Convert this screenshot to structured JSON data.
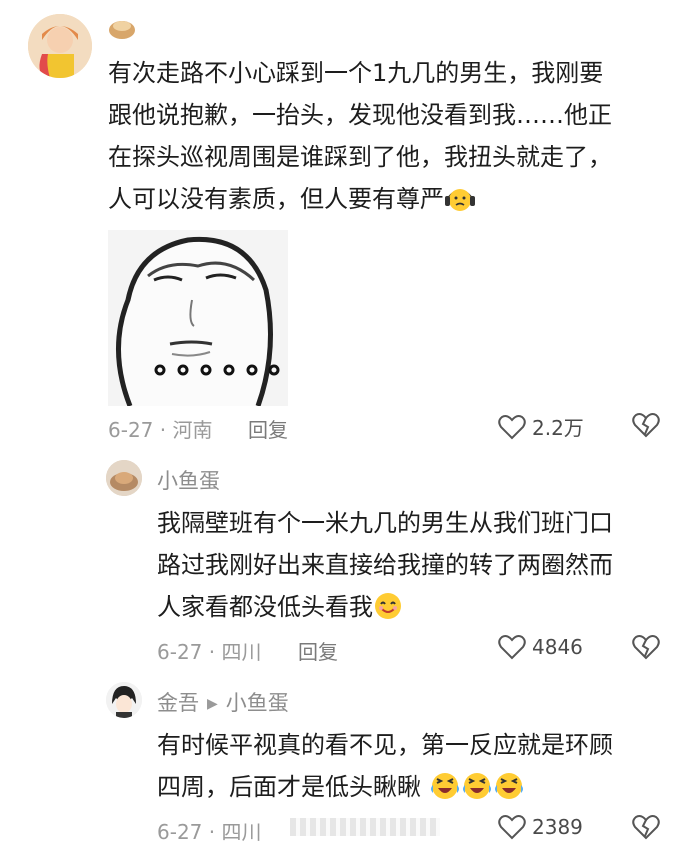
{
  "comments": [
    {
      "author": "",
      "text_lines": [
        "有次走路不小心踩到一个1九几的男生，我刚要",
        "跟他说抱歉，一抬头，发现他没看到我……他正",
        "在探头巡视周围是谁踩到了他，我扭头就走了，",
        "人可以没有素质，但人要有尊严"
      ],
      "meta": "6-27 · 河南",
      "reply_label": "回复",
      "like_count": "2.2万",
      "badge_icon": "bun-emoji-icon",
      "meme_icon": "face-meme-sticker"
    },
    {
      "author": "小鱼蛋",
      "text_lines": [
        "我隔壁班有个一米九几的男生从我们班门口",
        "路过我刚好出来直接给我撞的转了两圈然而",
        "人家看都没低头看我"
      ],
      "meta": "6-27 · 四川",
      "reply_label": "回复",
      "like_count": "4846"
    },
    {
      "author": "金吾",
      "reply_to": "小鱼蛋",
      "text_lines": [
        "有时候平视真的看不见，第一反应就是环顾",
        "四周，后面才是低头瞅瞅"
      ],
      "meta": "6-27 · 四川",
      "like_count": "2389"
    }
  ],
  "colors": {
    "text": "#1d1d1d",
    "meta": "#9a9a9a",
    "emoji_yellow": "#ffcc33"
  }
}
